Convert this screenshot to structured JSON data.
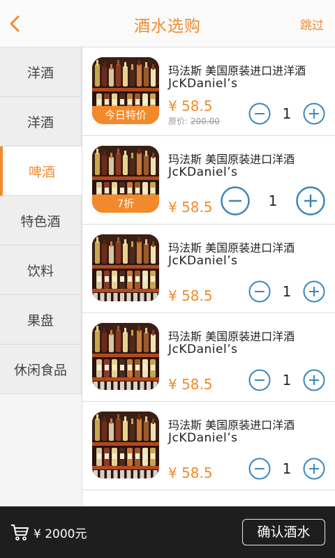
{
  "header": {
    "title": "酒水选购",
    "skip_label": "跳过",
    "back_icon": "chevron-left-icon",
    "accent_color": "#f28a2c"
  },
  "sidebar": {
    "items": [
      {
        "label": "洋酒",
        "active": false
      },
      {
        "label": "洋酒",
        "active": false
      },
      {
        "label": "啤酒",
        "active": true
      },
      {
        "label": "特色酒",
        "active": false
      },
      {
        "label": "饮料",
        "active": false
      },
      {
        "label": "果盘",
        "active": false
      },
      {
        "label": "休闲食品",
        "active": false
      }
    ]
  },
  "products": [
    {
      "name_line1": "玛法斯 美国原装进口进洋酒",
      "name_line2": "JcKDaniel’s",
      "price": "¥ 58.5",
      "original_label": "原价:",
      "original_price": "200.00",
      "tag": "今日特价",
      "quantity": "1"
    },
    {
      "name_line1": "玛法斯 美国原装进口洋酒",
      "name_line2": "JcKDaniel’s",
      "price": "¥ 58.5",
      "tag": "7折",
      "quantity": "1"
    },
    {
      "name_line1": "玛法斯 美国原装进口洋酒",
      "name_line2": "JcKDaniel’s",
      "price": "¥ 58.5",
      "quantity": "1"
    },
    {
      "name_line1": "玛法斯 美国原装进口洋酒",
      "name_line2": "JcKDaniel’s",
      "price": "¥ 58.5",
      "quantity": "1"
    },
    {
      "name_line1": "玛法斯 美国原装进口洋酒",
      "name_line2": "JcKDaniel’s",
      "price": "¥ 58.5",
      "quantity": "1"
    }
  ],
  "footer": {
    "cart_icon": "shopping-cart-icon",
    "total": "¥ 2000元",
    "confirm_label": "确认酒水"
  },
  "icons": {
    "minus": "minus-circle-icon",
    "plus": "plus-circle-icon",
    "circle_color": "#3d86b8"
  }
}
